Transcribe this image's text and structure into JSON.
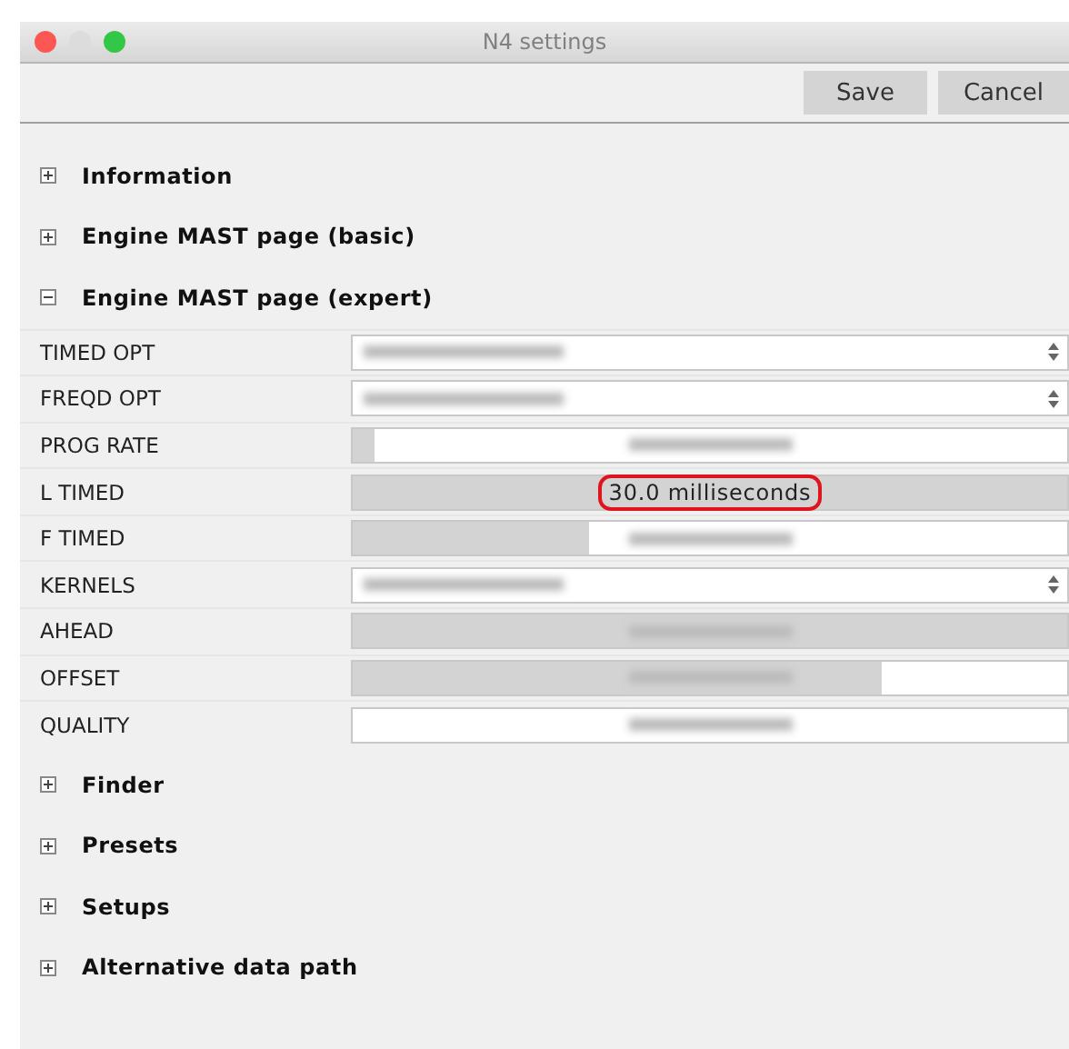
{
  "window": {
    "title": "N4 settings"
  },
  "toolbar": {
    "buttons": [
      "Save",
      "Cancel"
    ]
  },
  "sections_before": [
    {
      "title": "Information",
      "expanded": false
    },
    {
      "title": "Engine MAST page (basic)",
      "expanded": false
    },
    {
      "title": "Engine MAST page (expert)",
      "expanded": true
    }
  ],
  "settings": [
    {
      "label": "TIMED OPT",
      "kind": "select"
    },
    {
      "label": "FREQD OPT",
      "kind": "select"
    },
    {
      "label": "PROG RATE",
      "kind": "slider",
      "level": 0.03
    },
    {
      "label": "L TIMED",
      "kind": "slider",
      "level": 1,
      "value": "30.0 milliseconds",
      "highlighted": true
    },
    {
      "label": "F TIMED",
      "kind": "slider",
      "level": 0.33
    },
    {
      "label": "KERNELS",
      "kind": "select"
    },
    {
      "label": "AHEAD",
      "kind": "slider",
      "level": 1
    },
    {
      "label": "OFFSET",
      "kind": "slider",
      "level": 0.74
    },
    {
      "label": "QUALITY",
      "kind": "slider",
      "level": 0
    }
  ],
  "sections_after": [
    {
      "title": "Finder",
      "expanded": false
    },
    {
      "title": "Presets",
      "expanded": false
    },
    {
      "title": "Setups",
      "expanded": false
    },
    {
      "title": "Alternative data path",
      "expanded": false
    }
  ]
}
